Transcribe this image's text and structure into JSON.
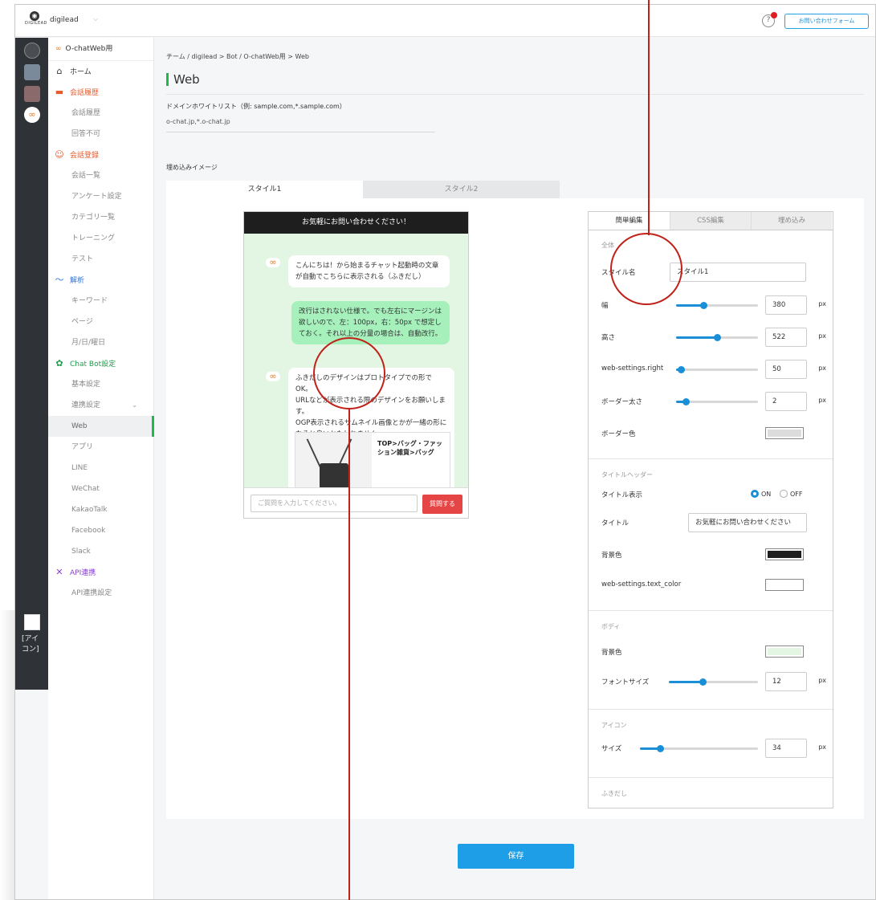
{
  "topbar": {
    "logo_text": "DIGILEAD",
    "team": "digilead",
    "contact_label": "お問い合わせフォーム"
  },
  "rail": {
    "broken_image_text": "[アイコン]"
  },
  "sidebar": {
    "bot_name": "O-chatWeb用",
    "items": [
      {
        "label": "ホーム",
        "type": "head",
        "icon": "home-icon"
      },
      {
        "label": "会話履歴",
        "type": "head red",
        "icon": "chat-icon"
      },
      {
        "label": "会話履歴",
        "type": "sub"
      },
      {
        "label": "回答不可",
        "type": "sub"
      },
      {
        "label": "会話登録",
        "type": "head red",
        "icon": "smile-icon"
      },
      {
        "label": "会話一覧",
        "type": "sub"
      },
      {
        "label": "アンケート設定",
        "type": "sub"
      },
      {
        "label": "カテゴリ一覧",
        "type": "sub"
      },
      {
        "label": "トレーニング",
        "type": "sub"
      },
      {
        "label": "テスト",
        "type": "sub"
      },
      {
        "label": "解析",
        "type": "head blue",
        "icon": "chart-icon"
      },
      {
        "label": "キーワード",
        "type": "sub"
      },
      {
        "label": "ページ",
        "type": "sub"
      },
      {
        "label": "月/日/曜日",
        "type": "sub"
      },
      {
        "label": "Chat Bot設定",
        "type": "head green",
        "icon": "gear-icon"
      },
      {
        "label": "基本設定",
        "type": "sub"
      },
      {
        "label": "連携設定",
        "type": "sub"
      },
      {
        "label": "Web",
        "type": "sub active"
      },
      {
        "label": "アプリ",
        "type": "sub"
      },
      {
        "label": "LINE",
        "type": "sub"
      },
      {
        "label": "WeChat",
        "type": "sub"
      },
      {
        "label": "KakaoTalk",
        "type": "sub"
      },
      {
        "label": "Facebook",
        "type": "sub"
      },
      {
        "label": "Slack",
        "type": "sub"
      },
      {
        "label": "API連携",
        "type": "head purple",
        "icon": "tools-icon"
      },
      {
        "label": "API連携設定",
        "type": "sub"
      }
    ]
  },
  "main": {
    "breadcrumb": "チーム / digilead  >  Bot / O-chatWeb用  >  Web",
    "title": "Web",
    "domain_label": "ドメインホワイトリスト（例: sample.com,*.sample.com）",
    "domain_value": "o-chat.jp,*.o-chat.jp",
    "embed_label": "埋め込みイメージ",
    "style_tabs": [
      "スタイル1",
      "スタイル2"
    ],
    "save_label": "保存"
  },
  "chat": {
    "header": "お気軽にお問い合わせください！",
    "msg1": "こんにちは！から始まるチャット起動時の文章が自動でこちらに表示される（ふきだし）",
    "msg2": "改行はされない仕様で。でも左右にマージンは欲しいので、左：100px，右：50px で想定しておく。それ以上の分量の場合は、自動改行。",
    "msg3": "ふきだしのデザインはプロトタイプでの形でOK。\nURLなどが表示される際のデザインをお願いします。\nOGP表示されるサムネイル画像とかが一緒の形になると良いかもしれません。",
    "card_title": "TOP>バッグ・ファッション雑貨>バッグ",
    "input_placeholder": "ご質問を入力してください。",
    "send_label": "質問する"
  },
  "editor": {
    "tabs": [
      "簡単編集",
      "CSS編集",
      "埋め込み"
    ],
    "sec_all": "全体",
    "style_name_label": "スタイル名",
    "style_name_value": "スタイル1",
    "width_label": "幅",
    "width_value": "380",
    "height_label": "高さ",
    "height_value": "522",
    "right_label": "web-settings.right",
    "right_value": "50",
    "border_w_label": "ボーダー太さ",
    "border_w_value": "2",
    "border_c_label": "ボーダー色",
    "px": "px",
    "sec_title": "タイトルヘッダー",
    "title_show_label": "タイトル表示",
    "on": "ON",
    "off": "OFF",
    "title_label": "タイトル",
    "title_value": "お気軽にお問い合わせください",
    "bg_label": "背景色",
    "text_color_label": "web-settings.text_color",
    "sec_body": "ボディ",
    "body_bg_label": "背景色",
    "font_label": "フォントサイズ",
    "font_value": "12",
    "sec_icon": "アイコン",
    "size_label": "サイズ",
    "size_value": "34",
    "sec_bubble": "ふきだし"
  },
  "sliders": {
    "width": 0.33,
    "height": 0.5,
    "right": 0.06,
    "border": 0.12,
    "font": 0.38,
    "icon": 0.17
  },
  "colors": {
    "accent": "#1fb84a",
    "blue": "#1a8fd8",
    "border_color": "#dcdcdc",
    "header_bg": "#1e1e1e",
    "text_color": "#ffffff",
    "body_bg": "#e3f6e3",
    "annotation": "#c0221a"
  }
}
